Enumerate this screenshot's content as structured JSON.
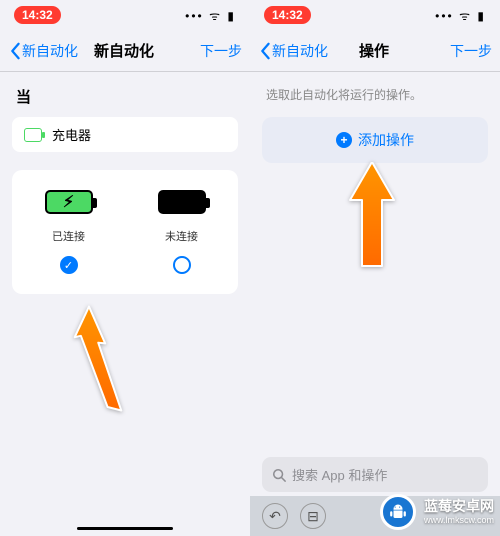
{
  "status": {
    "time": "14:32"
  },
  "nav": {
    "back": "新自动化",
    "title_left": "新自动化",
    "title_right": "操作",
    "next": "下一步"
  },
  "left": {
    "when": "当",
    "chip": "充电器",
    "opt_connected": "已连接",
    "opt_disconnected": "未连接"
  },
  "right": {
    "subtitle": "选取此自动化将运行的操作。",
    "add_action": "添加操作",
    "search_placeholder": "搜索 App 和操作"
  },
  "watermark": {
    "name": "蓝莓安卓网",
    "url": "www.lmkscw.com"
  }
}
